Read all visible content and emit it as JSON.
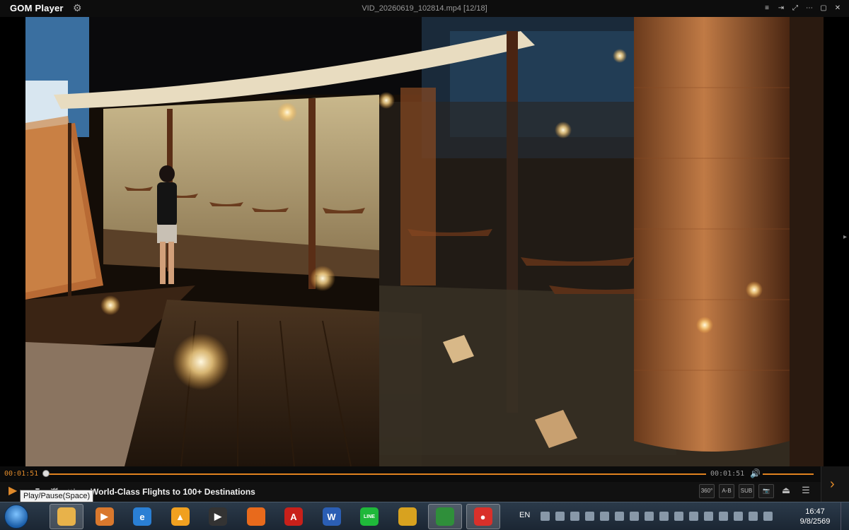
{
  "window": {
    "brand": "GOM Player",
    "file_title": "VID_20260619_102814.mp4  [12/18]",
    "buttons": [
      "≡",
      "⇥",
      "⤢",
      "⋯",
      "▢",
      "✕"
    ]
  },
  "playback": {
    "current_time": "00:01:51",
    "total_time": "00:01:51",
    "progress_fraction": 0.003,
    "volume_fraction": 1.0,
    "tooltip": "Play/Pause(Space)",
    "ticker": "World-Class Flights to 100+ Destinations"
  },
  "controls": {
    "icons": [
      {
        "name": "360-icon",
        "text": "360°"
      },
      {
        "name": "ab-repeat-icon",
        "text": "A-B"
      },
      {
        "name": "subtitle-icon",
        "text": "SUB"
      },
      {
        "name": "capture-icon",
        "text": "📷"
      },
      {
        "name": "eject-icon",
        "text": "⏏"
      },
      {
        "name": "menu-icon",
        "text": "☰"
      }
    ],
    "next_label": "›"
  },
  "colors": {
    "accent": "#e0821f"
  },
  "taskbar": {
    "apps": [
      {
        "name": "file-explorer",
        "glyph": "",
        "color": "#e8b24a",
        "active": true
      },
      {
        "name": "media-player",
        "glyph": "▶",
        "color": "#d9782d",
        "active": false
      },
      {
        "name": "internet-explorer",
        "glyph": "e",
        "color": "#2a7fd4",
        "active": false
      },
      {
        "name": "aimp",
        "glyph": "▲",
        "color": "#f0a020",
        "active": false
      },
      {
        "name": "gom-player",
        "glyph": "▶",
        "color": "#333",
        "active": false
      },
      {
        "name": "firefox",
        "glyph": "",
        "color": "#e86a1c",
        "active": false
      },
      {
        "name": "acrobat",
        "glyph": "A",
        "color": "#c8201a",
        "active": false
      },
      {
        "name": "word",
        "glyph": "W",
        "color": "#2b5eb4",
        "active": false
      },
      {
        "name": "line",
        "glyph": "LINE",
        "color": "#1fb83a",
        "active": false
      },
      {
        "name": "chrome",
        "glyph": "",
        "color": "#d8a21f",
        "active": false
      },
      {
        "name": "chrome-2",
        "glyph": "",
        "color": "#2f8f3a",
        "active": true
      },
      {
        "name": "gom-cam",
        "glyph": "●",
        "color": "#d9302a",
        "active": true
      }
    ],
    "language": "EN",
    "tray_icons": [
      "bt",
      "v",
      "p",
      "n",
      "e",
      "g",
      "s",
      "t",
      "c",
      "w",
      "y",
      "o",
      "b",
      "s",
      "f",
      "m"
    ],
    "clock_time": "16:47",
    "clock_date": "9/8/2569"
  }
}
